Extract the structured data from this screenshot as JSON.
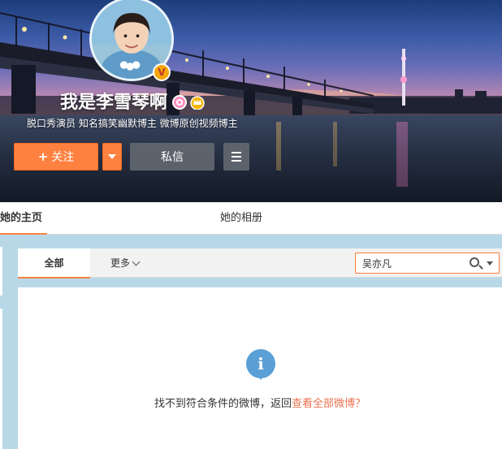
{
  "profile": {
    "screen_name": "我是李雪琴啊",
    "description": "脱口秀演员 知名搞笑幽默博主 微博原创视频博主",
    "verified_badge": "V",
    "icons": [
      "avatar",
      "verified-badge-icon",
      "female-icon",
      "crown-icon"
    ]
  },
  "actions": {
    "follow_plus": "+",
    "follow_label": "关注",
    "message_label": "私信"
  },
  "nav": {
    "tabs": [
      {
        "label": "她的主页",
        "active": true
      },
      {
        "label": "她的相册",
        "active": false
      }
    ]
  },
  "filter": {
    "all_label": "全部",
    "more_label": "更多",
    "search_value": "吴亦凡"
  },
  "empty_state": {
    "icon": "i",
    "message": "找不到符合条件的微博，返回",
    "link_text": "查看全部微博",
    "suffix": "？"
  },
  "colors": {
    "accent": "#ff8140",
    "link": "#eb7350",
    "info": "#5a9fd6"
  }
}
